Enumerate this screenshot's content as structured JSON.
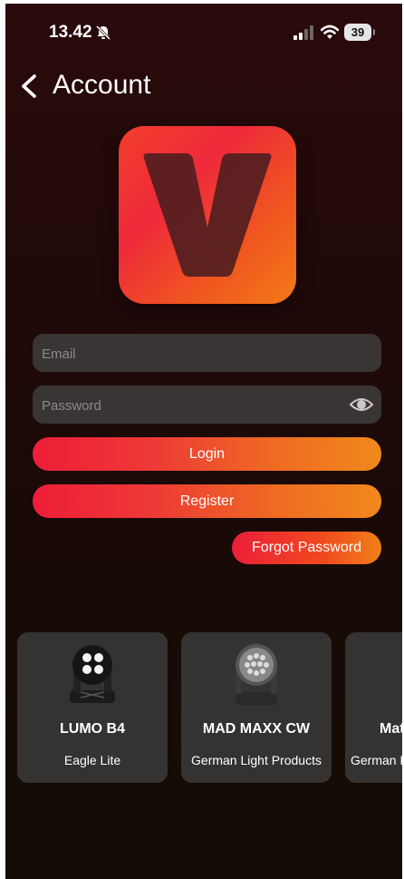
{
  "status_bar": {
    "time": "13.42",
    "battery": "39",
    "icons": [
      "bell-slash-icon",
      "signal-icon",
      "wifi-icon",
      "battery-icon"
    ]
  },
  "header": {
    "title": "Account",
    "back_icon": "chevron-left-icon"
  },
  "logo": {
    "letter": "V"
  },
  "form": {
    "email_placeholder": "Email",
    "password_placeholder": "Password",
    "eye_icon": "eye-icon",
    "login_label": "Login",
    "register_label": "Register",
    "forgot_label": "Forgot Password"
  },
  "products": [
    {
      "name": "LUMO B4",
      "brand": "Eagle Lite"
    },
    {
      "name": "MAD MAXX CW",
      "brand": "German Light Products"
    },
    {
      "name": "Mat",
      "brand": "German L"
    }
  ],
  "colors": {
    "accent_start": "#ee1d38",
    "accent_end": "#f0891c",
    "field_bg": "#3a3535",
    "card_bg": "#353232"
  }
}
